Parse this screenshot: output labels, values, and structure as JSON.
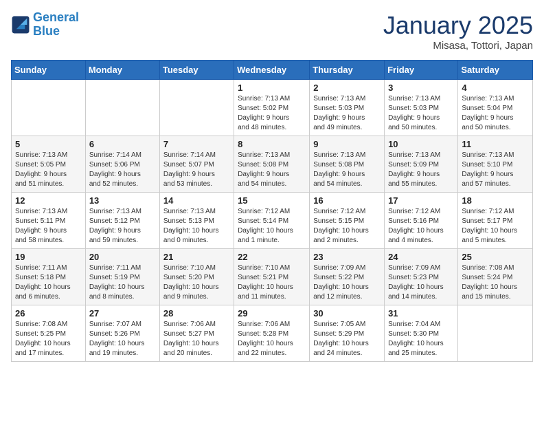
{
  "logo": {
    "line1": "General",
    "line2": "Blue"
  },
  "title": "January 2025",
  "location": "Misasa, Tottori, Japan",
  "days_of_week": [
    "Sunday",
    "Monday",
    "Tuesday",
    "Wednesday",
    "Thursday",
    "Friday",
    "Saturday"
  ],
  "weeks": [
    [
      {
        "day": "",
        "info": ""
      },
      {
        "day": "",
        "info": ""
      },
      {
        "day": "",
        "info": ""
      },
      {
        "day": "1",
        "info": "Sunrise: 7:13 AM\nSunset: 5:02 PM\nDaylight: 9 hours\nand 48 minutes."
      },
      {
        "day": "2",
        "info": "Sunrise: 7:13 AM\nSunset: 5:03 PM\nDaylight: 9 hours\nand 49 minutes."
      },
      {
        "day": "3",
        "info": "Sunrise: 7:13 AM\nSunset: 5:03 PM\nDaylight: 9 hours\nand 50 minutes."
      },
      {
        "day": "4",
        "info": "Sunrise: 7:13 AM\nSunset: 5:04 PM\nDaylight: 9 hours\nand 50 minutes."
      }
    ],
    [
      {
        "day": "5",
        "info": "Sunrise: 7:13 AM\nSunset: 5:05 PM\nDaylight: 9 hours\nand 51 minutes."
      },
      {
        "day": "6",
        "info": "Sunrise: 7:14 AM\nSunset: 5:06 PM\nDaylight: 9 hours\nand 52 minutes."
      },
      {
        "day": "7",
        "info": "Sunrise: 7:14 AM\nSunset: 5:07 PM\nDaylight: 9 hours\nand 53 minutes."
      },
      {
        "day": "8",
        "info": "Sunrise: 7:13 AM\nSunset: 5:08 PM\nDaylight: 9 hours\nand 54 minutes."
      },
      {
        "day": "9",
        "info": "Sunrise: 7:13 AM\nSunset: 5:08 PM\nDaylight: 9 hours\nand 54 minutes."
      },
      {
        "day": "10",
        "info": "Sunrise: 7:13 AM\nSunset: 5:09 PM\nDaylight: 9 hours\nand 55 minutes."
      },
      {
        "day": "11",
        "info": "Sunrise: 7:13 AM\nSunset: 5:10 PM\nDaylight: 9 hours\nand 57 minutes."
      }
    ],
    [
      {
        "day": "12",
        "info": "Sunrise: 7:13 AM\nSunset: 5:11 PM\nDaylight: 9 hours\nand 58 minutes."
      },
      {
        "day": "13",
        "info": "Sunrise: 7:13 AM\nSunset: 5:12 PM\nDaylight: 9 hours\nand 59 minutes."
      },
      {
        "day": "14",
        "info": "Sunrise: 7:13 AM\nSunset: 5:13 PM\nDaylight: 10 hours\nand 0 minutes."
      },
      {
        "day": "15",
        "info": "Sunrise: 7:12 AM\nSunset: 5:14 PM\nDaylight: 10 hours\nand 1 minute."
      },
      {
        "day": "16",
        "info": "Sunrise: 7:12 AM\nSunset: 5:15 PM\nDaylight: 10 hours\nand 2 minutes."
      },
      {
        "day": "17",
        "info": "Sunrise: 7:12 AM\nSunset: 5:16 PM\nDaylight: 10 hours\nand 4 minutes."
      },
      {
        "day": "18",
        "info": "Sunrise: 7:12 AM\nSunset: 5:17 PM\nDaylight: 10 hours\nand 5 minutes."
      }
    ],
    [
      {
        "day": "19",
        "info": "Sunrise: 7:11 AM\nSunset: 5:18 PM\nDaylight: 10 hours\nand 6 minutes."
      },
      {
        "day": "20",
        "info": "Sunrise: 7:11 AM\nSunset: 5:19 PM\nDaylight: 10 hours\nand 8 minutes."
      },
      {
        "day": "21",
        "info": "Sunrise: 7:10 AM\nSunset: 5:20 PM\nDaylight: 10 hours\nand 9 minutes."
      },
      {
        "day": "22",
        "info": "Sunrise: 7:10 AM\nSunset: 5:21 PM\nDaylight: 10 hours\nand 11 minutes."
      },
      {
        "day": "23",
        "info": "Sunrise: 7:09 AM\nSunset: 5:22 PM\nDaylight: 10 hours\nand 12 minutes."
      },
      {
        "day": "24",
        "info": "Sunrise: 7:09 AM\nSunset: 5:23 PM\nDaylight: 10 hours\nand 14 minutes."
      },
      {
        "day": "25",
        "info": "Sunrise: 7:08 AM\nSunset: 5:24 PM\nDaylight: 10 hours\nand 15 minutes."
      }
    ],
    [
      {
        "day": "26",
        "info": "Sunrise: 7:08 AM\nSunset: 5:25 PM\nDaylight: 10 hours\nand 17 minutes."
      },
      {
        "day": "27",
        "info": "Sunrise: 7:07 AM\nSunset: 5:26 PM\nDaylight: 10 hours\nand 19 minutes."
      },
      {
        "day": "28",
        "info": "Sunrise: 7:06 AM\nSunset: 5:27 PM\nDaylight: 10 hours\nand 20 minutes."
      },
      {
        "day": "29",
        "info": "Sunrise: 7:06 AM\nSunset: 5:28 PM\nDaylight: 10 hours\nand 22 minutes."
      },
      {
        "day": "30",
        "info": "Sunrise: 7:05 AM\nSunset: 5:29 PM\nDaylight: 10 hours\nand 24 minutes."
      },
      {
        "day": "31",
        "info": "Sunrise: 7:04 AM\nSunset: 5:30 PM\nDaylight: 10 hours\nand 25 minutes."
      },
      {
        "day": "",
        "info": ""
      }
    ]
  ]
}
